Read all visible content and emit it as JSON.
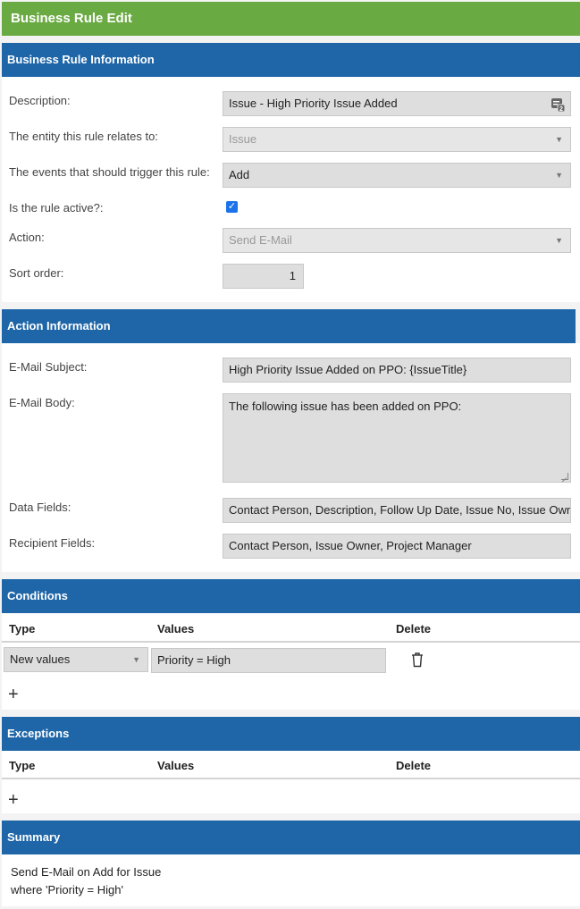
{
  "page_title": "Business Rule Edit",
  "business_rule": {
    "header": "Business Rule Information",
    "description_label": "Description:",
    "description_value": "Issue - High Priority Issue Added",
    "entity_label": "The entity this rule relates to:",
    "entity_value": "Issue",
    "events_label": "The events that should trigger this rule:",
    "events_value": "Add",
    "active_label": "Is the rule active?:",
    "active_checked": true,
    "action_label": "Action:",
    "action_value": "Send E-Mail",
    "sort_label": "Sort order:",
    "sort_value": "1"
  },
  "action_info": {
    "header": "Action Information",
    "subject_label": "E-Mail Subject:",
    "subject_value": "High Priority Issue Added on PPO: {IssueTitle}",
    "body_label": "E-Mail Body:",
    "body_value": "The following issue has been added on PPO:",
    "data_fields_label": "Data Fields:",
    "data_fields_value": "Contact Person, Description, Follow Up Date, Issue No, Issue Owner",
    "recipient_label": "Recipient Fields:",
    "recipient_value": "Contact Person, Issue Owner, Project Manager"
  },
  "conditions": {
    "header": "Conditions",
    "col_type": "Type",
    "col_values": "Values",
    "col_delete": "Delete",
    "row_type": "New values",
    "row_value": "Priority = High",
    "add_symbol": "+"
  },
  "exceptions": {
    "header": "Exceptions",
    "col_type": "Type",
    "col_values": "Values",
    "col_delete": "Delete",
    "add_symbol": "+"
  },
  "summary": {
    "header": "Summary",
    "line1": "Send E-Mail on Add for Issue",
    "line2": "where 'Priority = High'"
  },
  "icons": {
    "dropdown": "chevron-down-icon",
    "memo": "memo-icon",
    "delete": "trash-icon",
    "check": "checkmark-icon"
  },
  "colors": {
    "title_bar": "#6aaa42",
    "section_header": "#1f66a8",
    "checkbox": "#1a73e8"
  }
}
